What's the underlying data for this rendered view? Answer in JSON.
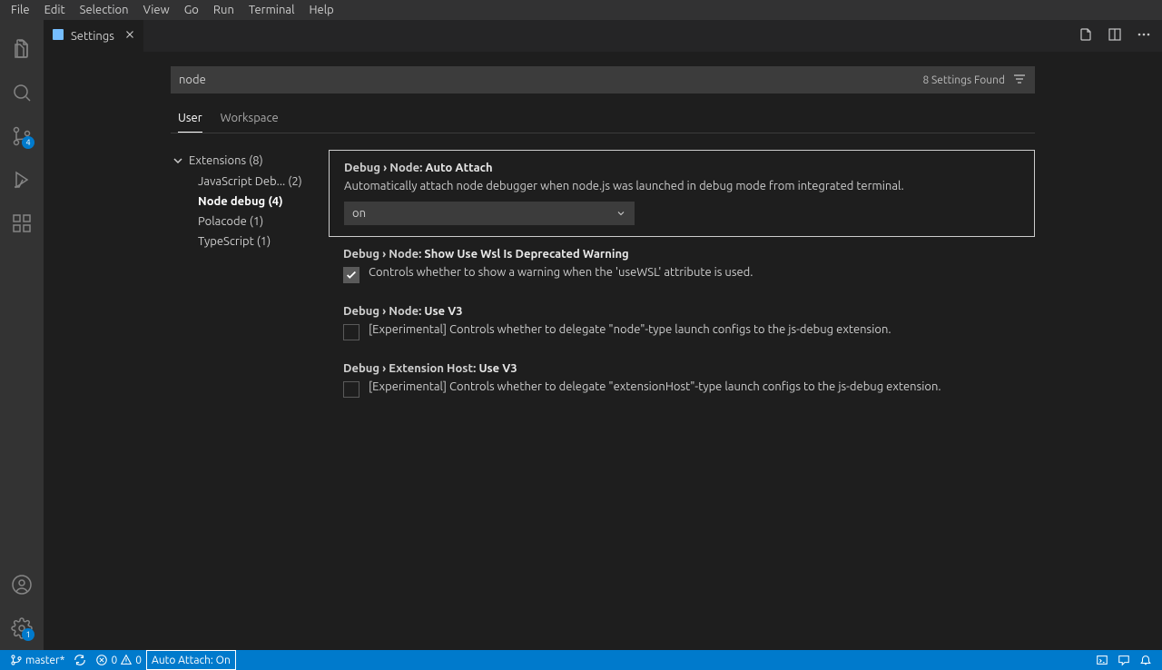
{
  "menubar": [
    "File",
    "Edit",
    "Selection",
    "View",
    "Go",
    "Run",
    "Terminal",
    "Help"
  ],
  "activity": {
    "scm_badge": "4",
    "settings_badge": "1"
  },
  "tab": {
    "title": "Settings"
  },
  "search": {
    "value": "node",
    "found": "8 Settings Found"
  },
  "scope": {
    "user": "User",
    "workspace": "Workspace"
  },
  "toc": {
    "head": "Extensions",
    "head_count": "(8)",
    "items": [
      {
        "label": "JavaScript Deb...",
        "count": "(2)"
      },
      {
        "label": "Node debug",
        "count": "(4)",
        "selected": true
      },
      {
        "label": "Polacode",
        "count": "(1)"
      },
      {
        "label": "TypeScript",
        "count": "(1)"
      }
    ]
  },
  "settings": [
    {
      "cat": "Debug › Node: ",
      "name": "Auto Attach",
      "desc": "Automatically attach node debugger when node.js was launched in debug mode from integrated terminal.",
      "type": "select",
      "value": "on",
      "focused": true
    },
    {
      "cat": "Debug › Node: ",
      "name": "Show Use Wsl Is Deprecated Warning",
      "desc": "Controls whether to show a warning when the 'useWSL' attribute is used.",
      "type": "checkbox",
      "checked": true
    },
    {
      "cat": "Debug › Node: ",
      "name": "Use V3",
      "desc": "[Experimental] Controls whether to delegate \"node\"-type launch configs to the js-debug extension.",
      "type": "checkbox",
      "checked": false
    },
    {
      "cat": "Debug › Extension Host: ",
      "name": "Use V3",
      "desc": "[Experimental] Controls whether to delegate \"extensionHost\"-type launch configs to the js-debug extension.",
      "type": "checkbox",
      "checked": false
    }
  ],
  "statusbar": {
    "branch": "master*",
    "errors": "0",
    "warnings": "0",
    "auto_attach": "Auto Attach: On"
  }
}
